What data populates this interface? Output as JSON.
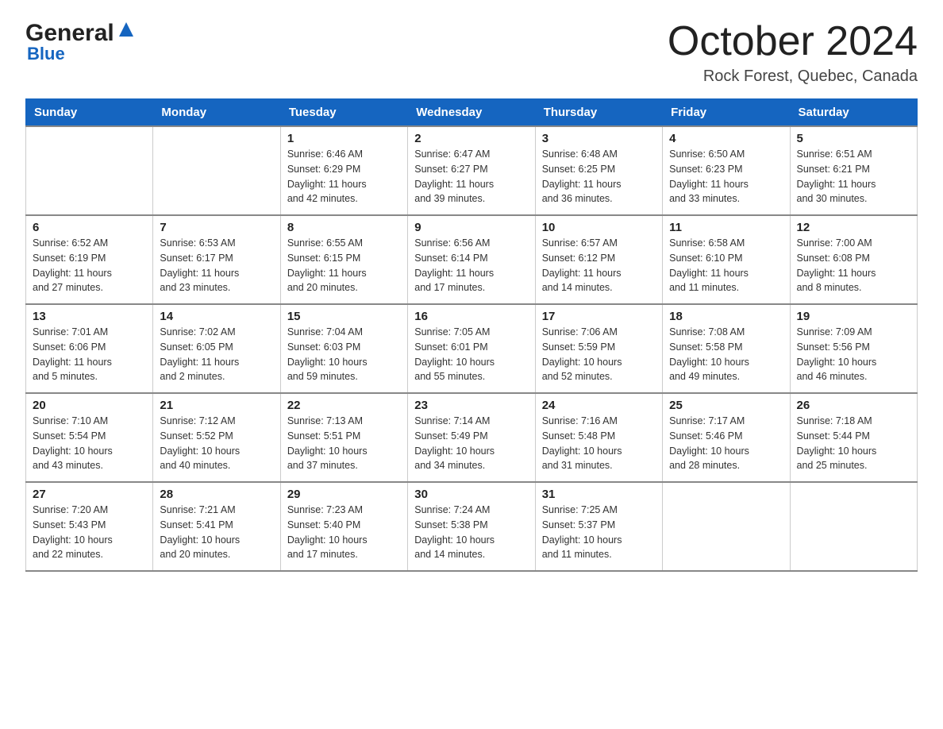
{
  "header": {
    "logo_general": "General",
    "logo_blue": "Blue",
    "title": "October 2024",
    "location": "Rock Forest, Quebec, Canada"
  },
  "calendar": {
    "days_of_week": [
      "Sunday",
      "Monday",
      "Tuesday",
      "Wednesday",
      "Thursday",
      "Friday",
      "Saturday"
    ],
    "weeks": [
      [
        {
          "day": "",
          "info": ""
        },
        {
          "day": "",
          "info": ""
        },
        {
          "day": "1",
          "info": "Sunrise: 6:46 AM\nSunset: 6:29 PM\nDaylight: 11 hours\nand 42 minutes."
        },
        {
          "day": "2",
          "info": "Sunrise: 6:47 AM\nSunset: 6:27 PM\nDaylight: 11 hours\nand 39 minutes."
        },
        {
          "day": "3",
          "info": "Sunrise: 6:48 AM\nSunset: 6:25 PM\nDaylight: 11 hours\nand 36 minutes."
        },
        {
          "day": "4",
          "info": "Sunrise: 6:50 AM\nSunset: 6:23 PM\nDaylight: 11 hours\nand 33 minutes."
        },
        {
          "day": "5",
          "info": "Sunrise: 6:51 AM\nSunset: 6:21 PM\nDaylight: 11 hours\nand 30 minutes."
        }
      ],
      [
        {
          "day": "6",
          "info": "Sunrise: 6:52 AM\nSunset: 6:19 PM\nDaylight: 11 hours\nand 27 minutes."
        },
        {
          "day": "7",
          "info": "Sunrise: 6:53 AM\nSunset: 6:17 PM\nDaylight: 11 hours\nand 23 minutes."
        },
        {
          "day": "8",
          "info": "Sunrise: 6:55 AM\nSunset: 6:15 PM\nDaylight: 11 hours\nand 20 minutes."
        },
        {
          "day": "9",
          "info": "Sunrise: 6:56 AM\nSunset: 6:14 PM\nDaylight: 11 hours\nand 17 minutes."
        },
        {
          "day": "10",
          "info": "Sunrise: 6:57 AM\nSunset: 6:12 PM\nDaylight: 11 hours\nand 14 minutes."
        },
        {
          "day": "11",
          "info": "Sunrise: 6:58 AM\nSunset: 6:10 PM\nDaylight: 11 hours\nand 11 minutes."
        },
        {
          "day": "12",
          "info": "Sunrise: 7:00 AM\nSunset: 6:08 PM\nDaylight: 11 hours\nand 8 minutes."
        }
      ],
      [
        {
          "day": "13",
          "info": "Sunrise: 7:01 AM\nSunset: 6:06 PM\nDaylight: 11 hours\nand 5 minutes."
        },
        {
          "day": "14",
          "info": "Sunrise: 7:02 AM\nSunset: 6:05 PM\nDaylight: 11 hours\nand 2 minutes."
        },
        {
          "day": "15",
          "info": "Sunrise: 7:04 AM\nSunset: 6:03 PM\nDaylight: 10 hours\nand 59 minutes."
        },
        {
          "day": "16",
          "info": "Sunrise: 7:05 AM\nSunset: 6:01 PM\nDaylight: 10 hours\nand 55 minutes."
        },
        {
          "day": "17",
          "info": "Sunrise: 7:06 AM\nSunset: 5:59 PM\nDaylight: 10 hours\nand 52 minutes."
        },
        {
          "day": "18",
          "info": "Sunrise: 7:08 AM\nSunset: 5:58 PM\nDaylight: 10 hours\nand 49 minutes."
        },
        {
          "day": "19",
          "info": "Sunrise: 7:09 AM\nSunset: 5:56 PM\nDaylight: 10 hours\nand 46 minutes."
        }
      ],
      [
        {
          "day": "20",
          "info": "Sunrise: 7:10 AM\nSunset: 5:54 PM\nDaylight: 10 hours\nand 43 minutes."
        },
        {
          "day": "21",
          "info": "Sunrise: 7:12 AM\nSunset: 5:52 PM\nDaylight: 10 hours\nand 40 minutes."
        },
        {
          "day": "22",
          "info": "Sunrise: 7:13 AM\nSunset: 5:51 PM\nDaylight: 10 hours\nand 37 minutes."
        },
        {
          "day": "23",
          "info": "Sunrise: 7:14 AM\nSunset: 5:49 PM\nDaylight: 10 hours\nand 34 minutes."
        },
        {
          "day": "24",
          "info": "Sunrise: 7:16 AM\nSunset: 5:48 PM\nDaylight: 10 hours\nand 31 minutes."
        },
        {
          "day": "25",
          "info": "Sunrise: 7:17 AM\nSunset: 5:46 PM\nDaylight: 10 hours\nand 28 minutes."
        },
        {
          "day": "26",
          "info": "Sunrise: 7:18 AM\nSunset: 5:44 PM\nDaylight: 10 hours\nand 25 minutes."
        }
      ],
      [
        {
          "day": "27",
          "info": "Sunrise: 7:20 AM\nSunset: 5:43 PM\nDaylight: 10 hours\nand 22 minutes."
        },
        {
          "day": "28",
          "info": "Sunrise: 7:21 AM\nSunset: 5:41 PM\nDaylight: 10 hours\nand 20 minutes."
        },
        {
          "day": "29",
          "info": "Sunrise: 7:23 AM\nSunset: 5:40 PM\nDaylight: 10 hours\nand 17 minutes."
        },
        {
          "day": "30",
          "info": "Sunrise: 7:24 AM\nSunset: 5:38 PM\nDaylight: 10 hours\nand 14 minutes."
        },
        {
          "day": "31",
          "info": "Sunrise: 7:25 AM\nSunset: 5:37 PM\nDaylight: 10 hours\nand 11 minutes."
        },
        {
          "day": "",
          "info": ""
        },
        {
          "day": "",
          "info": ""
        }
      ]
    ]
  }
}
